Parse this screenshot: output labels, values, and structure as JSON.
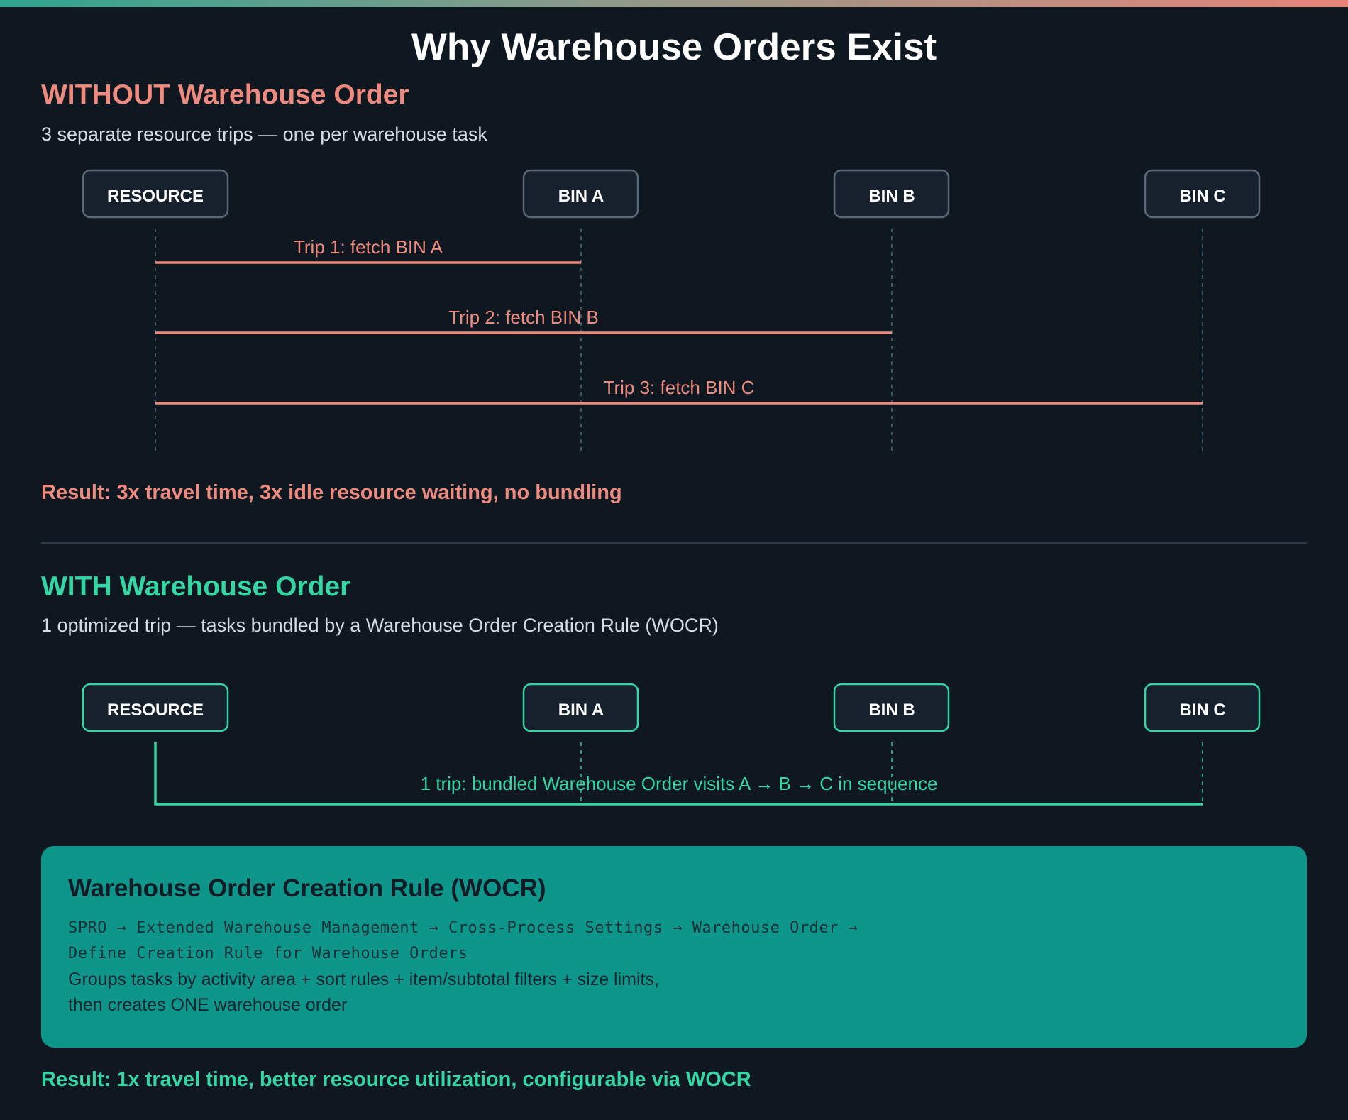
{
  "page": {
    "title": "Why Warehouse Orders Exist"
  },
  "without": {
    "title": "WITHOUT Warehouse Order",
    "subtitle": "3 separate resource trips — one per warehouse task",
    "nodes": [
      "RESOURCE",
      "BIN A",
      "BIN B",
      "BIN C"
    ],
    "trips": [
      "Trip 1: fetch BIN A",
      "Trip 2: fetch BIN B",
      "Trip 3: fetch BIN C"
    ],
    "result": "Result: 3x travel time, 3x idle resource waiting, no bundling"
  },
  "with": {
    "title": "WITH Warehouse Order",
    "subtitle": "1 optimized trip — tasks bundled by a Warehouse Order Creation Rule (WOCR)",
    "nodes": [
      "RESOURCE",
      "BIN A",
      "BIN B",
      "BIN C"
    ],
    "trip": "1 trip: bundled Warehouse Order visits A → B → C in sequence",
    "result": "Result: 1x travel time, better resource utilization, configurable via WOCR"
  },
  "wocr": {
    "title": "Warehouse Order Creation Rule (WOCR)",
    "path_line1": "SPRO → Extended Warehouse Management → Cross-Process Settings → Warehouse Order →",
    "path_line2": "Define Creation Rule for Warehouse Orders",
    "desc_line1": "Groups tasks by activity area + sort rules + item/subtotal filters + size limits,",
    "desc_line2": "then creates ONE warehouse order"
  },
  "colors": {
    "background": "#0f1720",
    "red_accent": "#ee8a7e",
    "green_accent": "#34d6a4",
    "wocr_box": "#0e968a",
    "node_fill": "#16212d",
    "node_border_without": "#5a6878",
    "node_border_with": "#34d6a4"
  }
}
